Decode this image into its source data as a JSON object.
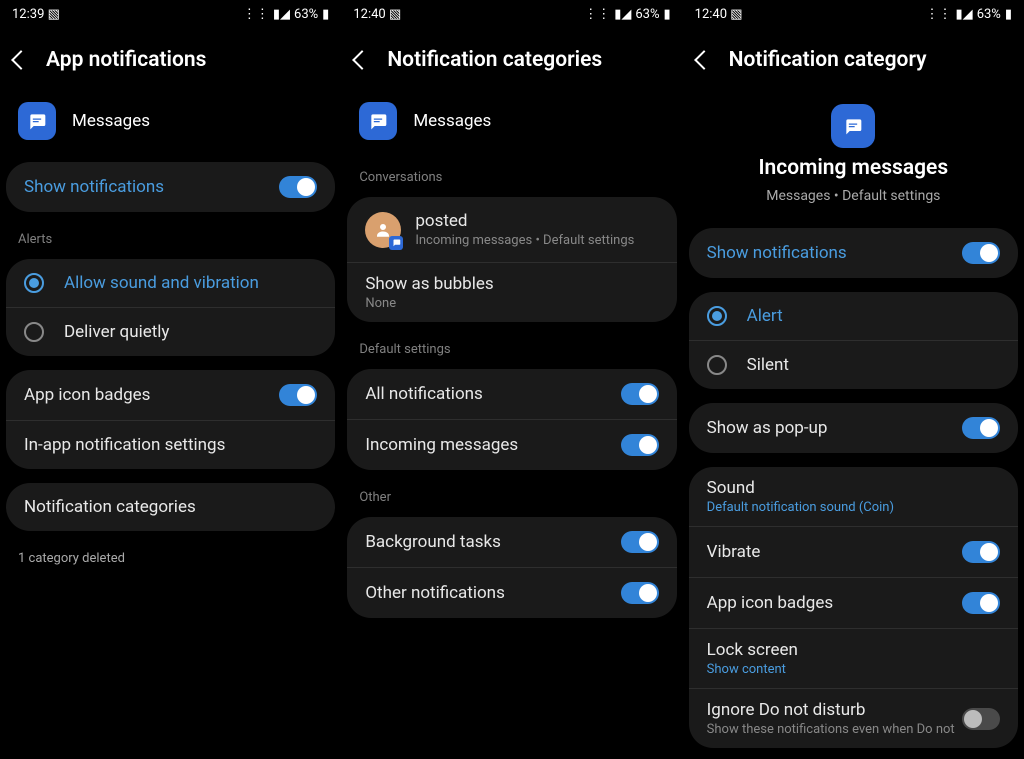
{
  "screens": [
    {
      "status": {
        "time": "12:39",
        "battery": "63%"
      },
      "title": "App notifications",
      "app": "Messages",
      "show_notifications": "Show notifications",
      "alerts_header": "Alerts",
      "radio_allow": "Allow sound and vibration",
      "radio_quiet": "Deliver quietly",
      "rows": {
        "badges": "App icon badges",
        "inapp": "In-app notification settings",
        "categories": "Notification categories"
      },
      "footer": "1 category deleted"
    },
    {
      "status": {
        "time": "12:40",
        "battery": "63%"
      },
      "title": "Notification categories",
      "app": "Messages",
      "headers": {
        "conv": "Conversations",
        "def": "Default settings",
        "other": "Other"
      },
      "posted": {
        "label": "posted",
        "sub": "Incoming messages • Default settings"
      },
      "bubbles": {
        "label": "Show as bubbles",
        "sub": "None"
      },
      "def_rows": {
        "all": "All notifications",
        "inc": "Incoming messages"
      },
      "other_rows": {
        "bg": "Background tasks",
        "ot": "Other notifications"
      }
    },
    {
      "status": {
        "time": "12:40",
        "battery": "63%"
      },
      "title": "Notification category",
      "center": {
        "big": "Incoming messages",
        "small": "Messages • Default settings"
      },
      "show_notifications": "Show notifications",
      "radio": {
        "alert": "Alert",
        "silent": "Silent"
      },
      "rows": {
        "popup": "Show as pop-up",
        "sound": "Sound",
        "sound_sub": "Default notification sound (Coin)",
        "vibrate": "Vibrate",
        "badges": "App icon badges",
        "lock": "Lock screen",
        "lock_sub": "Show content",
        "dnd": "Ignore Do not disturb",
        "dnd_sub": "Show these notifications even when Do not"
      }
    }
  ]
}
